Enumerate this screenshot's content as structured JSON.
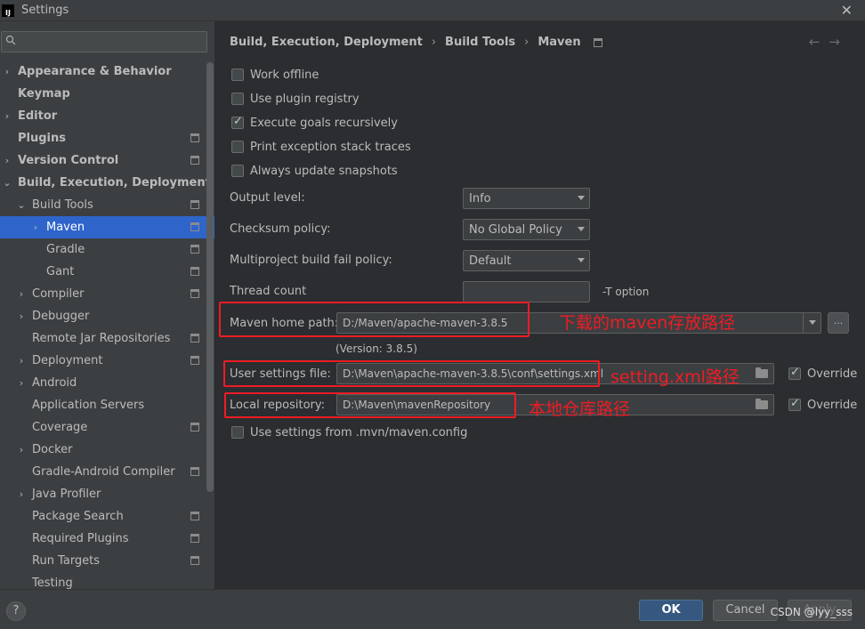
{
  "window": {
    "title": "Settings",
    "logo_text": "IJ"
  },
  "search": {
    "placeholder": ""
  },
  "sidebar": {
    "items": [
      {
        "label": "Appearance & Behavior",
        "level": 0,
        "arrow": "›",
        "bold": true,
        "badge": false
      },
      {
        "label": "Keymap",
        "level": 0,
        "arrow": "",
        "bold": true,
        "badge": false
      },
      {
        "label": "Editor",
        "level": 0,
        "arrow": "›",
        "bold": true,
        "badge": false
      },
      {
        "label": "Plugins",
        "level": 0,
        "arrow": "",
        "bold": true,
        "badge": true
      },
      {
        "label": "Version Control",
        "level": 0,
        "arrow": "›",
        "bold": true,
        "badge": true
      },
      {
        "label": "Build, Execution, Deployment",
        "level": 0,
        "arrow": "⌄",
        "bold": true,
        "badge": false
      },
      {
        "label": "Build Tools",
        "level": 1,
        "arrow": "⌄",
        "bold": false,
        "badge": true
      },
      {
        "label": "Maven",
        "level": 2,
        "arrow": "›",
        "bold": false,
        "badge": true,
        "selected": true
      },
      {
        "label": "Gradle",
        "level": 2,
        "arrow": "",
        "bold": false,
        "badge": true
      },
      {
        "label": "Gant",
        "level": 2,
        "arrow": "",
        "bold": false,
        "badge": true
      },
      {
        "label": "Compiler",
        "level": 1,
        "arrow": "›",
        "bold": false,
        "badge": true
      },
      {
        "label": "Debugger",
        "level": 1,
        "arrow": "›",
        "bold": false,
        "badge": false
      },
      {
        "label": "Remote Jar Repositories",
        "level": 1,
        "arrow": "",
        "bold": false,
        "badge": true
      },
      {
        "label": "Deployment",
        "level": 1,
        "arrow": "›",
        "bold": false,
        "badge": true
      },
      {
        "label": "Android",
        "level": 1,
        "arrow": "›",
        "bold": false,
        "badge": false
      },
      {
        "label": "Application Servers",
        "level": 1,
        "arrow": "",
        "bold": false,
        "badge": false
      },
      {
        "label": "Coverage",
        "level": 1,
        "arrow": "",
        "bold": false,
        "badge": true
      },
      {
        "label": "Docker",
        "level": 1,
        "arrow": "›",
        "bold": false,
        "badge": false
      },
      {
        "label": "Gradle-Android Compiler",
        "level": 1,
        "arrow": "",
        "bold": false,
        "badge": true
      },
      {
        "label": "Java Profiler",
        "level": 1,
        "arrow": "›",
        "bold": false,
        "badge": false
      },
      {
        "label": "Package Search",
        "level": 1,
        "arrow": "",
        "bold": false,
        "badge": true
      },
      {
        "label": "Required Plugins",
        "level": 1,
        "arrow": "",
        "bold": false,
        "badge": true
      },
      {
        "label": "Run Targets",
        "level": 1,
        "arrow": "",
        "bold": false,
        "badge": true
      },
      {
        "label": "Testing",
        "level": 1,
        "arrow": "",
        "bold": false,
        "badge": false
      }
    ]
  },
  "breadcrumb": {
    "items": [
      "Build, Execution, Deployment",
      "Build Tools",
      "Maven"
    ],
    "separator": "›",
    "nav_back": "←",
    "nav_forward": "→"
  },
  "options": {
    "work_offline": {
      "label": "Work offline",
      "checked": false
    },
    "use_plugin_registry": {
      "label": "Use plugin registry",
      "checked": false
    },
    "execute_goals": {
      "label": "Execute goals recursively",
      "checked": true
    },
    "print_exception": {
      "label": "Print exception stack traces",
      "checked": false
    },
    "always_update": {
      "label": "Always update snapshots",
      "checked": false
    },
    "use_mvn_config": {
      "label": "Use settings from .mvn/maven.config",
      "checked": false
    }
  },
  "form": {
    "output_level": {
      "label": "Output level:",
      "value": "Info"
    },
    "checksum_policy": {
      "label": "Checksum policy:",
      "value": "No Global Policy"
    },
    "fail_policy": {
      "label": "Multiproject build fail policy:",
      "value": "Default"
    },
    "thread_count": {
      "label": "Thread count",
      "value": "",
      "hint": "-T option"
    },
    "maven_home": {
      "label": "Maven home path:",
      "value": "D:/Maven/apache-maven-3.8.5",
      "version": "(Version: 3.8.5)",
      "browse": "..."
    },
    "user_settings": {
      "label": "User settings file:",
      "value": "D:\\Maven\\apache-maven-3.8.5\\conf\\settings.xml",
      "override_label": "Override",
      "override_checked": true
    },
    "local_repo": {
      "label": "Local repository:",
      "value": "D:\\Maven\\mavenRepository",
      "override_label": "Override",
      "override_checked": true
    }
  },
  "annotations": {
    "maven_home": "下载的maven存放路径",
    "settings_xml": "setting.xml路径",
    "local_repo": "本地仓库路径"
  },
  "footer": {
    "help": "?",
    "ok": "OK",
    "cancel": "Cancel",
    "apply": "Apply",
    "watermark": "CSDN @lyy_sss"
  },
  "colors": {
    "annotation_red": "#ee1c25",
    "selection_blue": "#2f65ca",
    "ok_button": "#365880"
  }
}
